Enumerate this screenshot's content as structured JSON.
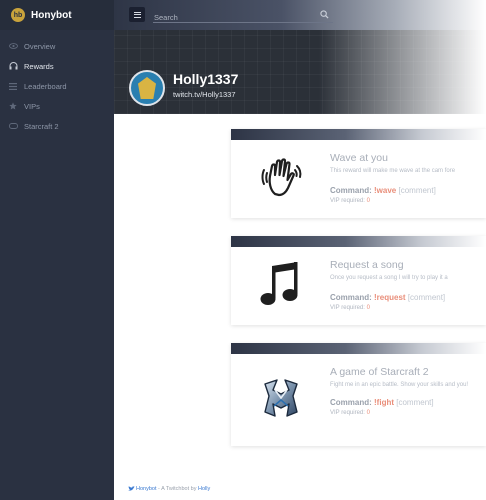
{
  "app": {
    "name": "Honybot",
    "logo_text": "hb"
  },
  "sidebar": {
    "items": [
      {
        "label": "Overview",
        "icon": "eye-icon"
      },
      {
        "label": "Rewards",
        "icon": "headset-icon",
        "active": true
      },
      {
        "label": "Leaderboard",
        "icon": "list-icon"
      },
      {
        "label": "VIPs",
        "icon": "star-icon"
      },
      {
        "label": "Starcraft 2",
        "icon": "gamepad-icon"
      }
    ]
  },
  "search": {
    "placeholder": "Search"
  },
  "profile": {
    "name": "Holly1337",
    "link": "twitch.tv/Holly1337"
  },
  "rewards": [
    {
      "title": "Wave at you",
      "description": "This reward will make me wave at the cam fore",
      "command_label": "Command:",
      "command": "!wave",
      "argument": "[comment]",
      "vip_label": "VIP required:",
      "vip_value": "0",
      "icon": "waving-hand-icon"
    },
    {
      "title": "Request a song",
      "description": "Once you request a song I will try to play it a",
      "command_label": "Command:",
      "command": "!request",
      "argument": "[comment]",
      "vip_label": "VIP required:",
      "vip_value": "0",
      "icon": "music-note-icon"
    },
    {
      "title": "A game of Starcraft 2",
      "description": "Fight me in an epic battle. Show your skills and you!",
      "command_label": "Command:",
      "command": "!fight",
      "argument": "[comment]",
      "vip_label": "VIP required:",
      "vip_value": "0",
      "icon": "starcraft-logo-icon"
    }
  ],
  "footer": {
    "brand": "Honybot",
    "text": "- A Twitchbot by",
    "author": "Holly"
  },
  "colors": {
    "sidebar": "#2a3141",
    "accent": "#e98e7a",
    "link": "#3b7ad1"
  }
}
